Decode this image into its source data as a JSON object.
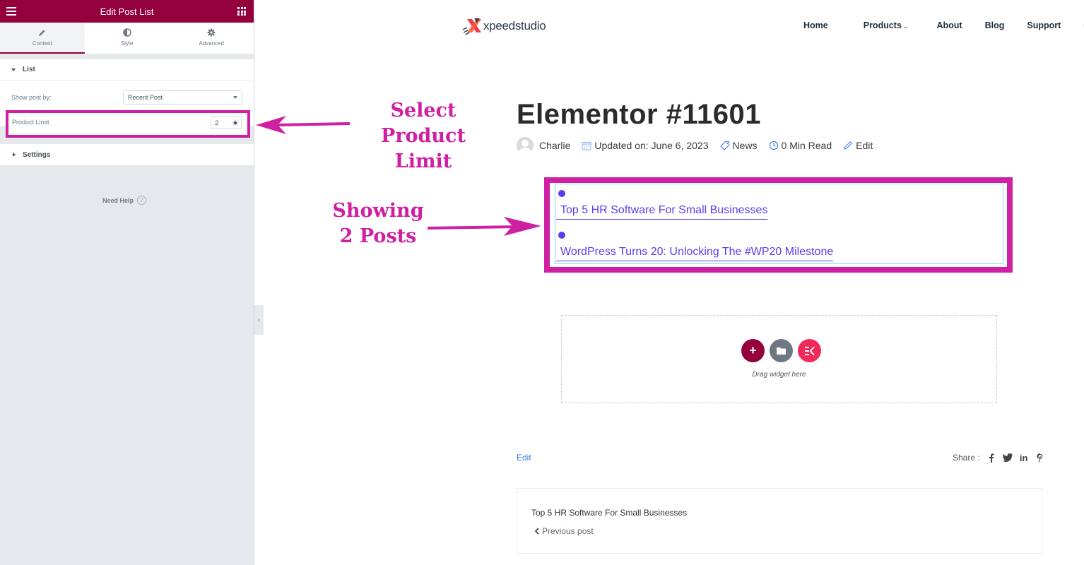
{
  "panel": {
    "title": "Edit Post List",
    "tabs": [
      {
        "label": "Content",
        "icon": "pencil-icon",
        "active": true
      },
      {
        "label": "Style",
        "icon": "half-circle-icon",
        "active": false
      },
      {
        "label": "Advanced",
        "icon": "gear-icon",
        "active": false
      }
    ],
    "list_section": {
      "label": "List",
      "show_post_by": {
        "label": "Show post by:",
        "value": "Recent Post"
      },
      "product_limit": {
        "label": "Product Limit",
        "value": "2"
      }
    },
    "settings_section": {
      "label": "Settings"
    },
    "need_help": {
      "label": "Need Help",
      "icon": "?"
    },
    "accent_color": "#93003c"
  },
  "site": {
    "logo_text": "xpeedstudio",
    "nav": [
      {
        "label": "Home"
      },
      {
        "label": "Products",
        "dropdown": true
      },
      {
        "label": "About"
      },
      {
        "label": "Blog"
      },
      {
        "label": "Support"
      },
      {
        "label": "Cont"
      }
    ]
  },
  "article": {
    "title": "Elementor #11601",
    "meta": {
      "author": "Charlie",
      "updated": "Updated on: June 6, 2023",
      "category": "News",
      "read_time": "0 Min Read",
      "edit": "Edit"
    },
    "post_list": [
      {
        "title": "Top 5 HR Software For Small Businesses"
      },
      {
        "title": "WordPress Turns 20: Unlocking The #WP20 Milestone"
      }
    ],
    "link_color": "#5b3cf0",
    "drop_zone": {
      "text": "Drag widget here"
    },
    "edit_link": "Edit",
    "share_label": "Share :",
    "share_icons": [
      "facebook-icon",
      "twitter-icon",
      "linkedin-icon",
      "pinterest-icon"
    ],
    "post_nav": {
      "title": "Top 5 HR Software For Small Businesses",
      "prev_label": "Previous post"
    }
  },
  "annotations": {
    "select_limit": [
      "Select Product",
      "Limit"
    ],
    "showing_posts": [
      "Showing",
      "2 Posts"
    ],
    "color": "#cf1fa2"
  }
}
